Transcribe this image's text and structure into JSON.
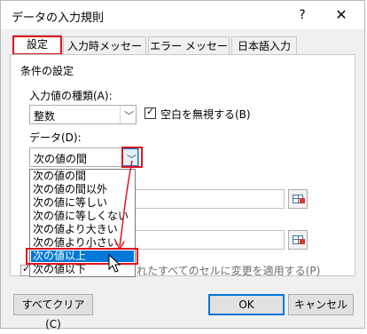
{
  "window": {
    "title": "データの入力規則",
    "help_label": "?",
    "close_label": "✕"
  },
  "tabs": [
    {
      "label": "設定"
    },
    {
      "label": "入力時メッセージ"
    },
    {
      "label": "エラー メッセージ"
    },
    {
      "label": "日本語入力"
    }
  ],
  "settings": {
    "section_label": "条件の設定",
    "allow_label": "入力値の種類(A):",
    "allow_value": "整数",
    "ignore_blank_label": "空白を無視する(B)",
    "ignore_blank_checked": true,
    "data_label": "データ(D):",
    "data_value": "次の値の間",
    "apply_all_label": "同じ入力規則が設定されたすべてのセルに変更を適用する(P)",
    "apply_all_visible_part": "れたすべてのセルに変更を適用する(P)"
  },
  "data_options": [
    "次の値の間",
    "次の値の間以外",
    "次の値に等しい",
    "次の値に等しくない",
    "次の値より大きい",
    "次の値より小さい",
    "次の値以上",
    "次の値以下"
  ],
  "selected_option": "次の値以上",
  "buttons": {
    "clear_all": "すべてクリア(C)",
    "ok": "OK",
    "cancel": "キャンセル"
  },
  "annotation_color": "#e0141e",
  "icons": {
    "help": "help-icon",
    "close": "close-icon",
    "dropdown": "chevron-down-icon",
    "ref": "range-select-icon",
    "cursor": "mouse-pointer-icon"
  }
}
